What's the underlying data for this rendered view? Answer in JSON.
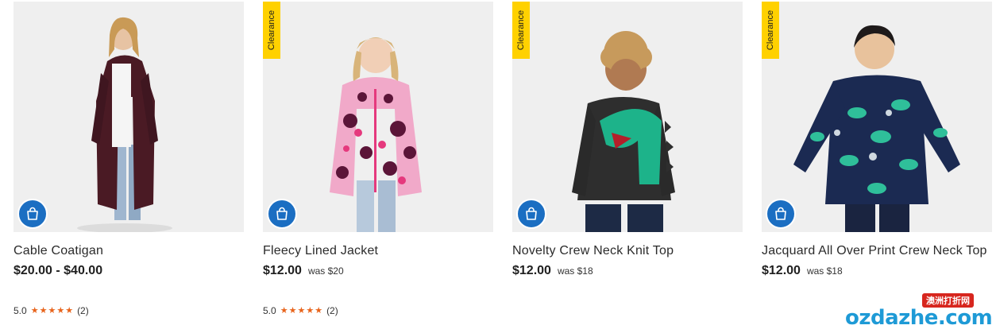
{
  "products": [
    {
      "name": "Cable Coatigan",
      "price": "$20.00 - $40.00",
      "was": "",
      "badge": "",
      "rating": "5.0",
      "review_count": "(2)",
      "stars": 5,
      "bag_icon": "shopping-bag-icon"
    },
    {
      "name": "Fleecy Lined Jacket",
      "price": "$12.00",
      "was": "was $20",
      "badge": "Clearance",
      "rating": "5.0",
      "review_count": "(2)",
      "stars": 5,
      "bag_icon": "shopping-bag-icon"
    },
    {
      "name": "Novelty Crew Neck Knit Top",
      "price": "$12.00",
      "was": "was $18",
      "badge": "Clearance",
      "rating": "",
      "review_count": "",
      "stars": 0,
      "bag_icon": "shopping-bag-icon"
    },
    {
      "name": "Jacquard All Over Print Crew Neck Top",
      "price": "$12.00",
      "was": "was $18",
      "badge": "Clearance",
      "rating": "",
      "review_count": "",
      "stars": 0,
      "bag_icon": "shopping-bag-icon"
    }
  ],
  "watermark": {
    "tag": "澳洲打折网",
    "text": "ozdazhe.com"
  },
  "colors": {
    "accent_blue": "#1b6ec2",
    "clearance_yellow": "#ffd100",
    "star_orange": "#e8641c"
  }
}
